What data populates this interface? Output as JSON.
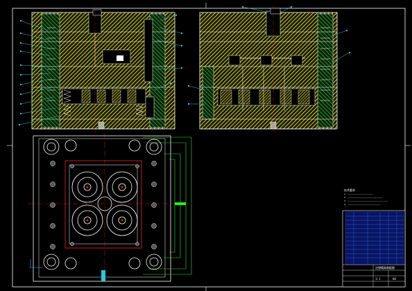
{
  "drawing": {
    "notes_title": "技术要求",
    "notes": [
      "1. ————————————————————",
      "2. ————————————————————————————",
      "3. ————————————————————————————————",
      "4. ——————————————————————————"
    ],
    "titleblock": {
      "drawing_name": "注塑模具装配图",
      "scale": "1:1",
      "sheet": "A0"
    }
  },
  "colors": {
    "background": "#000000",
    "frame": "#ffffff",
    "hatch_yellow": "#ffff33",
    "hatch_green": "#3cc83c",
    "outline_white": "#ffffff",
    "part_blue": "#2a6cff",
    "leader_cyan": "#26c9e0",
    "center_red": "#ff2020",
    "dim_green": "#22ee22",
    "table_blue": "#2040ff"
  }
}
